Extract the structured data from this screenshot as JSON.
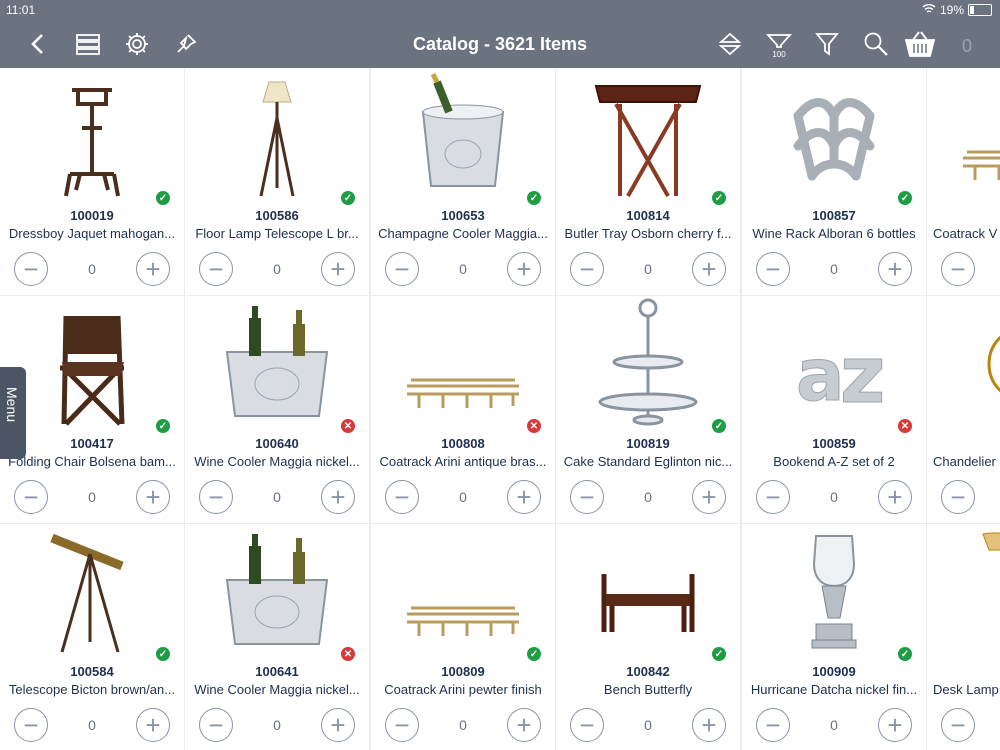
{
  "status": {
    "time": "11:01",
    "battery": "19%"
  },
  "header": {
    "title": "Catalog - 3621 Items",
    "filter_count": "100",
    "cart_count": "0"
  },
  "menu_label": "Menu",
  "items": [
    {
      "sku": "100019",
      "name": "Dressboy Jaquet mahogan...",
      "qty": "0",
      "status": "ok",
      "icon": "valet-stand"
    },
    {
      "sku": "100586",
      "name": "Floor Lamp Telescope L br...",
      "qty": "0",
      "status": "ok",
      "icon": "floor-lamp"
    },
    {
      "sku": "100653",
      "name": "Champagne Cooler Maggia...",
      "qty": "0",
      "status": "ok",
      "icon": "champagne-cooler"
    },
    {
      "sku": "100814",
      "name": "Butler Tray Osborn cherry f...",
      "qty": "0",
      "status": "ok",
      "icon": "butler-tray"
    },
    {
      "sku": "100857",
      "name": "Wine Rack Alboran 6 bottles",
      "qty": "0",
      "status": "ok",
      "icon": "wine-rack"
    },
    {
      "sku": "",
      "name": "Coatrack V",
      "qty": "",
      "status": "",
      "icon": "coatrack"
    },
    {
      "sku": "100417",
      "name": "Folding Chair Bolsena bam...",
      "qty": "0",
      "status": "ok",
      "icon": "folding-chair"
    },
    {
      "sku": "100640",
      "name": "Wine Cooler Maggia nickel...",
      "qty": "0",
      "status": "no",
      "icon": "wine-cooler"
    },
    {
      "sku": "100808",
      "name": "Coatrack Arini antique bras...",
      "qty": "0",
      "status": "no",
      "icon": "coatrack"
    },
    {
      "sku": "100819",
      "name": "Cake Standard Eglinton nic...",
      "qty": "0",
      "status": "ok",
      "icon": "cake-stand"
    },
    {
      "sku": "100859",
      "name": "Bookend  A-Z set of 2",
      "qty": "0",
      "status": "no",
      "icon": "bookend"
    },
    {
      "sku": "",
      "name": "Chandelier",
      "qty": "",
      "status": "",
      "icon": "chandelier"
    },
    {
      "sku": "100584",
      "name": "Telescope Bicton brown/an...",
      "qty": "0",
      "status": "ok",
      "icon": "telescope"
    },
    {
      "sku": "100641",
      "name": "Wine Cooler Maggia nickel...",
      "qty": "0",
      "status": "no",
      "icon": "wine-cooler"
    },
    {
      "sku": "100809",
      "name": "Coatrack Arini pewter finish",
      "qty": "0",
      "status": "ok",
      "icon": "coatrack"
    },
    {
      "sku": "100842",
      "name": "Bench Butterfly",
      "qty": "0",
      "status": "ok",
      "icon": "bench"
    },
    {
      "sku": "100909",
      "name": "Hurricane Datcha nickel fin...",
      "qty": "0",
      "status": "ok",
      "icon": "hurricane-lamp"
    },
    {
      "sku": "",
      "name": "Desk Lamp",
      "qty": "",
      "status": "",
      "icon": "desk-lamp"
    }
  ]
}
